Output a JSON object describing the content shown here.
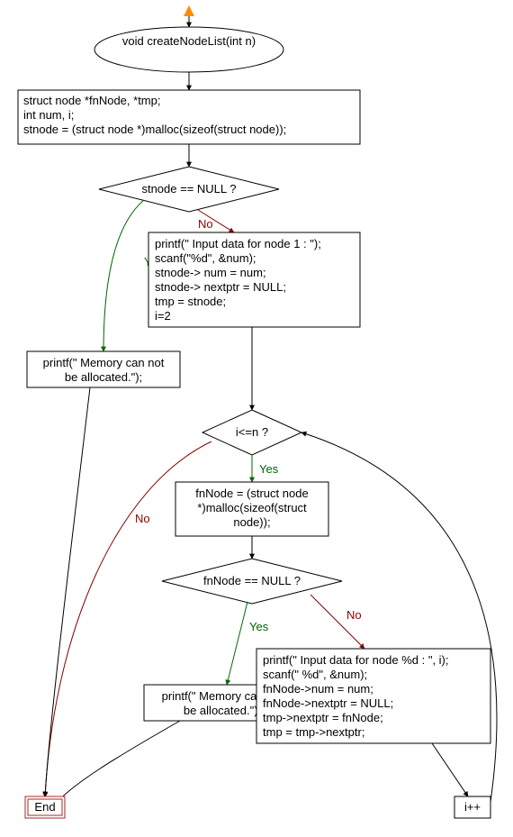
{
  "flowchart": {
    "start": "void createNodeList(int n)",
    "declBlock": {
      "l1": "struct node *fnNode, *tmp;",
      "l2": "int num, i;",
      "l3": "stnode = (struct node *)malloc(sizeof(struct node));"
    },
    "cond1": "stnode == NULL ?",
    "cond1_yes": "Yes",
    "cond1_no": "No",
    "memFail1": "printf(\" Memory can not be allocated.\");",
    "initBlock": {
      "l1": "printf(\" Input data for node 1 : \");",
      "l2": "scanf(\"%d\", &num);",
      "l3": "stnode-> num = num;",
      "l4": "stnode-> nextptr = NULL;",
      "l5": "tmp = stnode;",
      "l6": "i=2"
    },
    "cond2": "i<=n ?",
    "cond2_yes": "Yes",
    "cond2_no": "No",
    "allocBlock": {
      "l1": "fnNode = (struct node",
      "l2": "*)malloc(sizeof(struct",
      "l3": "node));"
    },
    "cond3": "fnNode == NULL ?",
    "cond3_yes": "Yes",
    "cond3_no": "No",
    "memFail2": "printf(\" Memory can not be allocated.\");",
    "loopBody": {
      "l1": "printf(\" Input data for node %d : \", i);",
      "l2": "scanf(\" %d\", &num);",
      "l3": "fnNode->num = num;",
      "l4": "fnNode->nextptr = NULL;",
      "l5": "tmp->nextptr = fnNode;",
      "l6": "tmp = tmp->nextptr;"
    },
    "incr": "i++",
    "end": "End"
  },
  "colors": {
    "fill": "#ffffff",
    "stroke": "#000000",
    "endStroke": "#A52A2A",
    "startArrow": "#FF8C00",
    "yes": "#006400",
    "no": "#8B0000"
  }
}
